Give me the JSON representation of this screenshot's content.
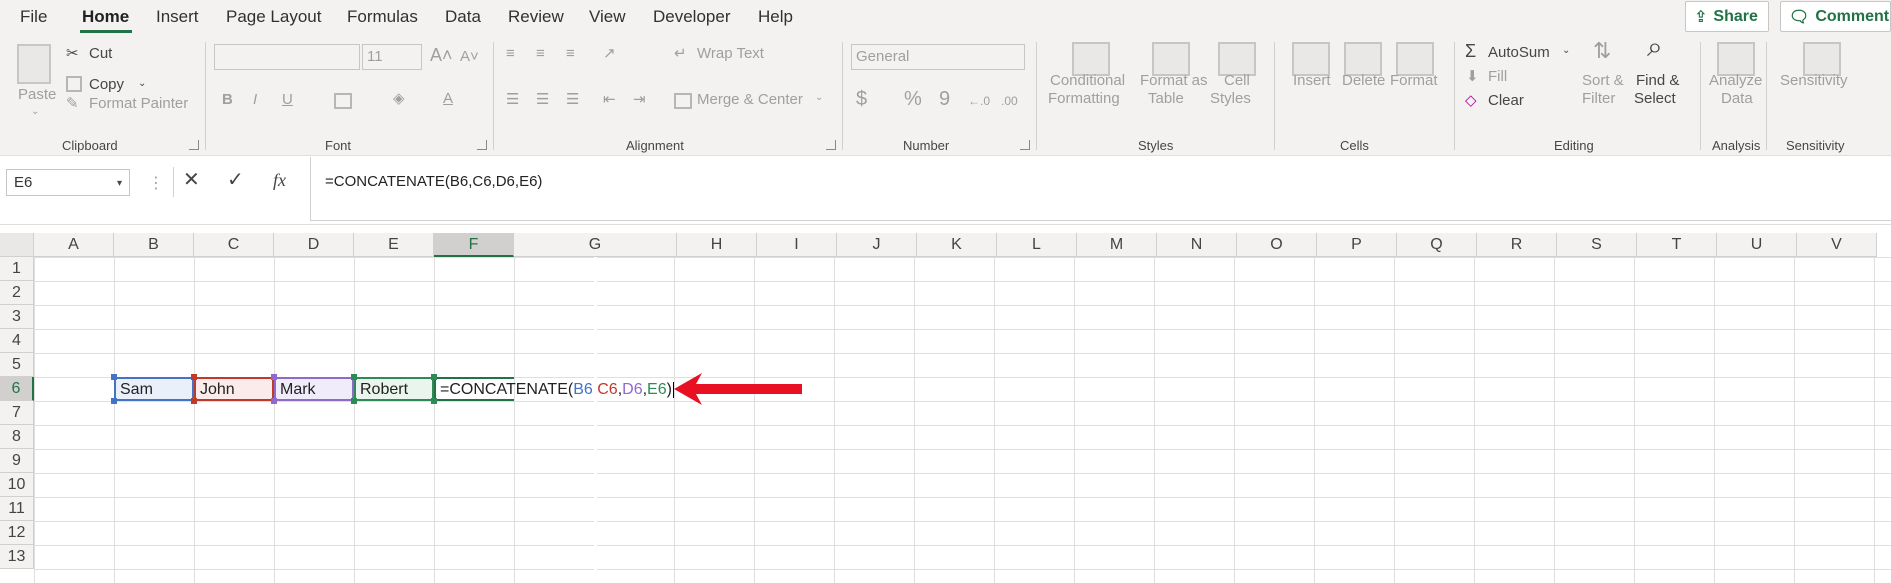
{
  "menu": {
    "tabs": [
      "File",
      "Home",
      "Insert",
      "Page Layout",
      "Formulas",
      "Data",
      "Review",
      "View",
      "Developer",
      "Help"
    ],
    "active_tab": "Home",
    "share_label": "Share",
    "comments_label": "Comments"
  },
  "ribbon": {
    "clipboard": {
      "paste": "Paste",
      "cut": "Cut",
      "copy": "Copy",
      "format_painter": "Format Painter",
      "group": "Clipboard"
    },
    "font": {
      "font_size": "11",
      "bold": "B",
      "italic": "I",
      "underline": "U",
      "group": "Font"
    },
    "alignment": {
      "wrap_text": "Wrap Text",
      "merge_center": "Merge & Center",
      "group": "Alignment"
    },
    "number": {
      "format": "General",
      "currency": "$",
      "percent": "%",
      "comma": "9",
      "group": "Number"
    },
    "styles": {
      "conditional": "Conditional",
      "formatting": "Formatting",
      "format_as": "Format as",
      "table": "Table",
      "cell": "Cell",
      "styles": "Styles",
      "group": "Styles"
    },
    "cells": {
      "insert": "Insert",
      "delete": "Delete",
      "format": "Format",
      "group": "Cells"
    },
    "editing": {
      "autosum": "AutoSum",
      "fill": "Fill",
      "clear": "Clear",
      "sort": "Sort &",
      "filter": "Filter",
      "find": "Find &",
      "select": "Select",
      "group": "Editing"
    },
    "analysis": {
      "analyze": "Analyze",
      "data": "Data",
      "group": "Analysis"
    },
    "sensitivity": {
      "label": "Sensitivity",
      "group": "Sensitivity"
    }
  },
  "formula_bar": {
    "name_box": "E6",
    "fx": "fx",
    "formula": "=CONCATENATE(B6,C6,D6,E6)"
  },
  "grid": {
    "columns": [
      "A",
      "B",
      "C",
      "D",
      "E",
      "F",
      "G",
      "H",
      "I",
      "J",
      "K",
      "L",
      "M",
      "N",
      "O",
      "P",
      "Q",
      "R",
      "S",
      "T",
      "U",
      "V"
    ],
    "rows": [
      "1",
      "2",
      "3",
      "4",
      "5",
      "6",
      "7",
      "8",
      "9",
      "10",
      "11",
      "12",
      "13"
    ],
    "selected_column": "F",
    "selected_row": "6",
    "cells": {
      "B6": "Sam",
      "C6": "John",
      "D6": "Mark",
      "E6": "Robert",
      "F6_prefix": "=CONCATENATE(",
      "F6_ref1": "B6",
      "F6_ref2": "C6",
      "F6_ref3": "D6",
      "F6_ref4": "E6",
      "comma": ",",
      "close": ")"
    }
  },
  "colors": {
    "accent_green": "#217346",
    "ref_blue": "#4472c4",
    "ref_red": "#c0392b",
    "ref_purple": "#8e6bc9",
    "ref_green": "#2e8b57",
    "arrow_red": "#e81123"
  }
}
